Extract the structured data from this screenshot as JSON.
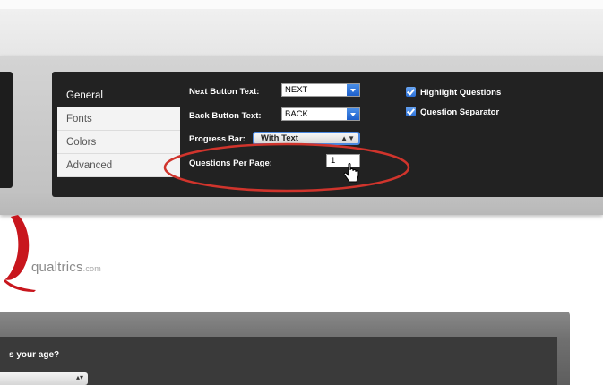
{
  "settings": {
    "tabs": [
      {
        "label": "General",
        "active": true
      },
      {
        "label": "Fonts",
        "active": false
      },
      {
        "label": "Colors",
        "active": false
      },
      {
        "label": "Advanced",
        "active": false
      }
    ],
    "next_button": {
      "label": "Next Button Text:",
      "value": "NEXT"
    },
    "back_button": {
      "label": "Back Button Text:",
      "value": "BACK"
    },
    "progress_bar": {
      "label": "Progress Bar:",
      "value": "With Text"
    },
    "questions_per_page": {
      "label": "Questions Per Page:",
      "value": "1"
    },
    "checkboxes": [
      {
        "label": "Highlight Questions",
        "checked": true
      },
      {
        "label": "Question Separator",
        "checked": true
      }
    ]
  },
  "logo": {
    "name": "qualtrics",
    "domain": ".com"
  },
  "survey": {
    "question_text": "s your age?"
  },
  "colors": {
    "accent_blue": "#2a6fd6",
    "highlight_red": "#d0342c",
    "dark_panel": "#222222"
  }
}
